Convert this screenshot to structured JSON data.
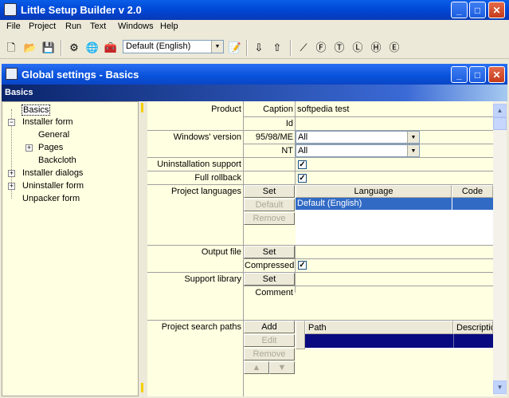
{
  "window": {
    "title": "Little Setup Builder v 2.0"
  },
  "menu": [
    "File",
    "Project",
    "Run",
    "Text",
    "Windows",
    "Help"
  ],
  "toolbar": {
    "language": "Default (English)"
  },
  "child": {
    "title": "Global settings - Basics"
  },
  "section": {
    "title": "Basics"
  },
  "tree": {
    "items": [
      {
        "label": "Basics"
      },
      {
        "label": "Installer form"
      },
      {
        "label": "General"
      },
      {
        "label": "Pages"
      },
      {
        "label": "Backcloth"
      },
      {
        "label": "Installer dialogs"
      },
      {
        "label": "Uninstaller form"
      },
      {
        "label": "Unpacker form"
      }
    ]
  },
  "props": {
    "product": {
      "label": "Product",
      "caption_label": "Caption",
      "caption_value": "softpedia test",
      "id_label": "Id",
      "id_value": ""
    },
    "windows": {
      "label": "Windows' version",
      "os1_label": "95/98/ME",
      "os1_value": "All",
      "os2_label": "NT",
      "os2_value": "All"
    },
    "uninstall_support": {
      "label": "Uninstallation support",
      "checked": true
    },
    "full_rollback": {
      "label": "Full rollback",
      "checked": true
    },
    "languages": {
      "label": "Project languages",
      "buttons": [
        "Set",
        "Default",
        "Remove"
      ],
      "columns": [
        "Language",
        "Code"
      ],
      "rows": [
        {
          "language": "Default (English)",
          "code": ""
        }
      ]
    },
    "output_file": {
      "label": "Output file",
      "button": "Set",
      "compressed_label": "Compressed",
      "compressed": true
    },
    "support_library": {
      "label": "Support library",
      "button": "Set",
      "comment_label": "Comment",
      "comment": ""
    },
    "search_paths": {
      "label": "Project search paths",
      "buttons": [
        "Add",
        "Edit",
        "Remove"
      ],
      "columns": [
        "Path",
        "Description"
      ]
    }
  }
}
